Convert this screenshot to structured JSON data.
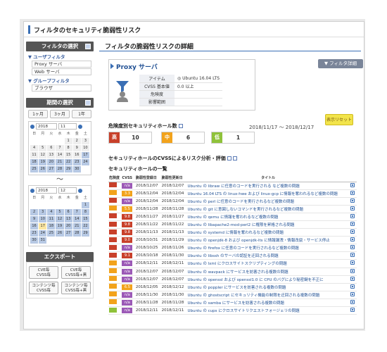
{
  "page_title": "フィルタのセキュリティ脆弱性リスク",
  "sidebar": {
    "filter_head": "フィルタの選択",
    "groups": [
      {
        "label": "▼ ユーザフィルタ",
        "items": [
          "Proxy サーバ",
          "Web サーバ"
        ]
      },
      {
        "label": "▼ グループフィルタ",
        "items": [
          "ブラウザ"
        ]
      }
    ],
    "period_head": "期間の選択",
    "periods": [
      "1ヶ月",
      "3ヶ月",
      "1年"
    ],
    "cal1": {
      "year": "2018",
      "month": "11"
    },
    "cal2": {
      "year": "2018",
      "month": "12"
    },
    "weekdays": [
      "日",
      "月",
      "火",
      "水",
      "木",
      "金",
      "土"
    ],
    "cal1_days": [
      "",
      "",
      "",
      "",
      "1",
      "2",
      "3",
      "4",
      "5",
      "6",
      "7",
      "8",
      "9",
      "10",
      "11",
      "12",
      "13",
      "14",
      "15",
      "16",
      "17",
      "18",
      "19",
      "20",
      "21",
      "22",
      "23",
      "24",
      "25",
      "26",
      "27",
      "28",
      "29",
      "30",
      ""
    ],
    "cal2_days": [
      "",
      "",
      "",
      "",
      "",
      "",
      "1",
      "2",
      "3",
      "4",
      "5",
      "6",
      "7",
      "8",
      "9",
      "10",
      "11",
      "12",
      "13",
      "14",
      "15",
      "16",
      "17",
      "18",
      "19",
      "20",
      "21",
      "22",
      "23",
      "24",
      "25",
      "26",
      "27",
      "28",
      "29",
      "30",
      "31",
      "",
      "",
      "",
      "",
      ""
    ],
    "tilde": "〜",
    "export_head": "エクスポート",
    "export_buttons": [
      "CVE毎\nCVSS毎",
      "CVE毎\nCVSS毎+黒",
      "コンテンツ毎\nCVSS毎",
      "コンテンツ毎\nCVSS毎+黒"
    ]
  },
  "main": {
    "title": "フィルタの脆弱性リスクの詳細",
    "filter_detail_btn": "▼ フィルタ詳細",
    "filter_name": "Proxy サーバ",
    "props": [
      {
        "k": "アイテム",
        "v": "◎ Ubuntu 16.04 LTS"
      },
      {
        "k": "CVSS 基本値",
        "v": "0.0 以上"
      },
      {
        "k": "危険度",
        "v": ""
      },
      {
        "k": "影響範囲",
        "v": ""
      }
    ],
    "danger_label": "危険度別セキュリティホール数",
    "date_range": "2018/11/17 〜 2018/12/17",
    "reset_btn": "表示リセット",
    "sev": [
      {
        "label": "高",
        "count": "10",
        "color": "#c8402a"
      },
      {
        "label": "中",
        "count": "6",
        "color": "#f2a31c"
      },
      {
        "label": "低",
        "count": "1",
        "color": "#8fc23a"
      }
    ],
    "cvss_section": "セキュリティホールのCVSSによるリスク分析・評価",
    "list_section": "セキュリティホールの一覧",
    "headers": [
      "危険度",
      "CVSS",
      "脆弱性登録日",
      "脆弱性更新日",
      "タイトル",
      ""
    ],
    "rows": [
      {
        "risk": "#c8402a",
        "cvss": "n/a",
        "cc": "#9b59b6",
        "d1": "2018/12/07",
        "d2": "2018/12/07",
        "title": "Ubuntu の libraw に任意のコードを実行される など複数の問題"
      },
      {
        "risk": "#f2a31c",
        "cvss": "3.3",
        "cc": "#f2a31c",
        "d1": "2018/12/04",
        "d2": "2018/12/04",
        "title": "Ubuntu 16.04 LTS の linux-hwe および linux-gcp に情報を奪われるなど複数の問題"
      },
      {
        "risk": "#c8402a",
        "cvss": "n/a",
        "cc": "#9b59b6",
        "d1": "2018/12/04",
        "d2": "2018/12/04",
        "title": "Ubuntu の perl に任意のコードを実行されるなど複数の問題"
      },
      {
        "risk": "#f2a31c",
        "cvss": "5.5",
        "cc": "#f2a31c",
        "d1": "2018/11/28",
        "d2": "2018/11/28",
        "title": "Ubuntu の git に意図しないコマンドを実行されるなど複数の問題"
      },
      {
        "risk": "#c8402a",
        "cvss": "9.8",
        "cc": "#c8402a",
        "d1": "2018/11/27",
        "d2": "2018/11/27",
        "title": "Ubuntu の qemu に情報を奪われるなど複数の問題"
      },
      {
        "risk": "#c8402a",
        "cvss": "9.8",
        "cc": "#c8402a",
        "d1": "2018/11/22",
        "d2": "2018/11/22",
        "title": "Ubuntu の libapache2-mod-perl2 に権限を昇格される問題"
      },
      {
        "risk": "#c8402a",
        "cvss": "9.8",
        "cc": "#c8402a",
        "d1": "2018/11/13",
        "d2": "2018/11/13",
        "title": "Ubuntu の systemd に情報を奪われるなど複数の問題"
      },
      {
        "risk": "#c8402a",
        "cvss": "9.0",
        "cc": "#c8402a",
        "d1": "2018/10/31",
        "d2": "2018/11/29",
        "title": "Ubuntu の openjdk-8 および openjdk-lts に情報漏洩・情報改竄・サービス停止"
      },
      {
        "risk": "#c8402a",
        "cvss": "n/a",
        "cc": "#9b59b6",
        "d1": "2018/10/25",
        "d2": "2018/11/26",
        "title": "Ubuntu の firefox に任意のコードを実行されるなど複数の問題"
      },
      {
        "risk": "#c8402a",
        "cvss": "9.1",
        "cc": "#c8402a",
        "d1": "2018/10/18",
        "d2": "2018/11/30",
        "title": "Ubuntu の libssh のサーバの認証を迂回される問題"
      },
      {
        "risk": "#f2a31c",
        "cvss": "n/a",
        "cc": "#9b59b6",
        "d1": "2018/12/11",
        "d2": "2018/12/11",
        "title": "Ubuntu の lxml にクロスサイトスクリプティングの問題"
      },
      {
        "risk": "#f2a31c",
        "cvss": "n/a",
        "cc": "#9b59b6",
        "d1": "2018/12/07",
        "d2": "2018/12/07",
        "title": "Ubuntu の wavpack にサービスを妨害される複数の問題"
      },
      {
        "risk": "#f2a31c",
        "cvss": "n/a",
        "cc": "#9b59b6",
        "d1": "2018/12/07",
        "d2": "2018/12/07",
        "title": "Ubuntu の openssl および openssl1.0 に CPU のバグにより秘密鍵を不正に"
      },
      {
        "risk": "#f2a31c",
        "cvss": "6.5",
        "cc": "#f2a31c",
        "d1": "2018/12/05",
        "d2": "2018/12/12",
        "title": "Ubuntu の poppler にサービスを妨害される複数の問題"
      },
      {
        "risk": "#f2a31c",
        "cvss": "n/a",
        "cc": "#9b59b6",
        "d1": "2018/11/30",
        "d2": "2018/11/30",
        "title": "Ubuntu の ghostscript にセキュリティ機能の制限を迂回される複数の問題"
      },
      {
        "risk": "#f2a31c",
        "cvss": "n/a",
        "cc": "#9b59b6",
        "d1": "2018/11/28",
        "d2": "2018/11/28",
        "title": "Ubuntu の samba にサービスを妨害される複数の問題"
      },
      {
        "risk": "#8fc23a",
        "cvss": "n/a",
        "cc": "#9b59b6",
        "d1": "2018/12/11",
        "d2": "2018/12/11",
        "title": "Ubuntu の cups にクロスサイトリクエストフォージェリの問題"
      }
    ]
  }
}
